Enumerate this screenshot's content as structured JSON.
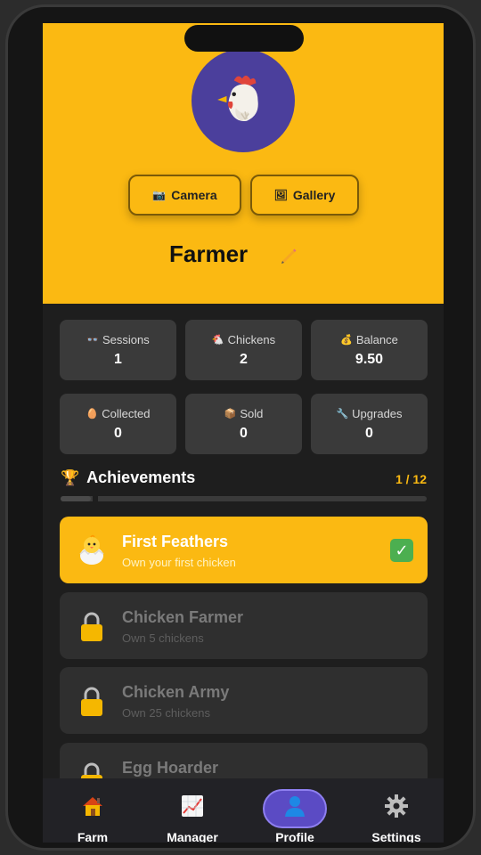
{
  "hero": {
    "camera_label": "Camera",
    "gallery_label": "Gallery",
    "player_name": "Farmer",
    "camera_icon": "📷",
    "gallery_icon": "🖼"
  },
  "stats": [
    {
      "icon": "👓",
      "label": "Sessions",
      "value": "1"
    },
    {
      "icon": "🐔",
      "label": "Chickens",
      "value": "2"
    },
    {
      "icon": "💰",
      "label": "Balance",
      "value": "9.50"
    },
    {
      "icon": "🥚",
      "label": "Collected",
      "value": "0"
    },
    {
      "icon": "📦",
      "label": "Sold",
      "value": "0"
    },
    {
      "icon": "🔧",
      "label": "Upgrades",
      "value": "0"
    }
  ],
  "achievements": {
    "title": "Achievements",
    "trophy_icon": "🏆",
    "count": "1 / 12",
    "progress": 0.0833,
    "items": [
      {
        "title": "First Feathers",
        "desc": "Own your first chicken",
        "unlocked": true,
        "check": "✓"
      },
      {
        "title": "Chicken Farmer",
        "desc": "Own 5 chickens",
        "unlocked": false
      },
      {
        "title": "Chicken Army",
        "desc": "Own 25 chickens",
        "unlocked": false
      },
      {
        "title": "Egg Hoarder",
        "desc": "",
        "unlocked": false
      }
    ]
  },
  "nav": {
    "farm": "Farm",
    "manager": "Manager",
    "profile": "Profile",
    "settings": "Settings"
  },
  "colors": {
    "accent": "#fbb912",
    "avatar_bg": "#4b3f9c",
    "profile_pill": "#5b4bc4",
    "card_bg": "#2f2f2f"
  }
}
